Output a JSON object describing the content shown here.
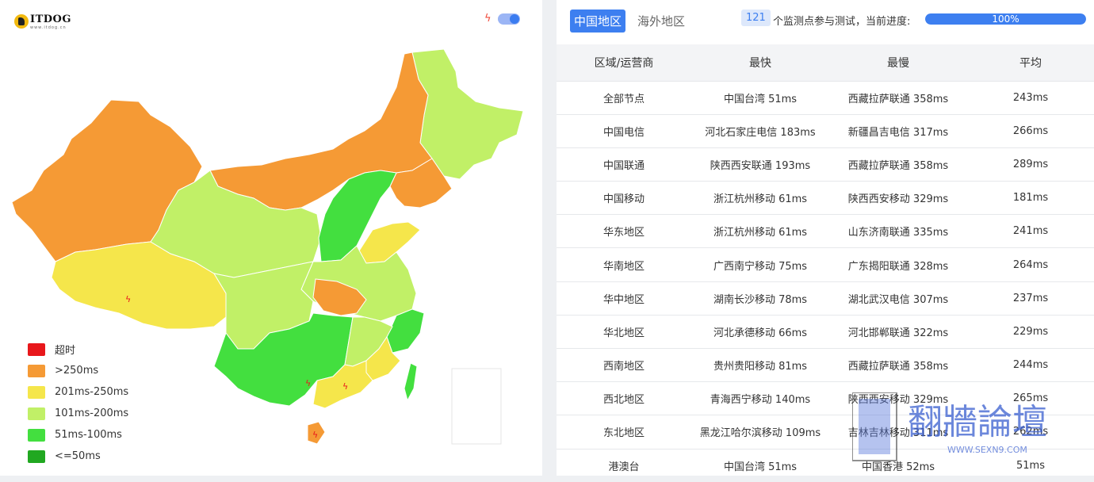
{
  "brand": {
    "name": "ITDOG",
    "url": "www.itdog.cn"
  },
  "legend": [
    {
      "label": "超时",
      "color": "#e8171b"
    },
    {
      "label": ">250ms",
      "color": "#f59a35"
    },
    {
      "label": "201ms-250ms",
      "color": "#f5e64b"
    },
    {
      "label": "101ms-200ms",
      "color": "#c1f067"
    },
    {
      "label": "51ms-100ms",
      "color": "#43df3f"
    },
    {
      "label": "<=50ms",
      "color": "#21a821"
    }
  ],
  "tabs": {
    "china": "中国地区",
    "overseas": "海外地区"
  },
  "test": {
    "count": "121",
    "text": "个监测点参与测试，当前进度:",
    "progress": "100%",
    "progress_value": 100
  },
  "table": {
    "headers": [
      "区域/运营商",
      "最快",
      "最慢",
      "平均"
    ],
    "rows": [
      [
        "全部节点",
        "中国台湾 51ms",
        "西藏拉萨联通 358ms",
        "243ms"
      ],
      [
        "中国电信",
        "河北石家庄电信 183ms",
        "新疆昌吉电信 317ms",
        "266ms"
      ],
      [
        "中国联通",
        "陕西西安联通 193ms",
        "西藏拉萨联通 358ms",
        "289ms"
      ],
      [
        "中国移动",
        "浙江杭州移动 61ms",
        "陕西西安移动 329ms",
        "181ms"
      ],
      [
        "华东地区",
        "浙江杭州移动 61ms",
        "山东济南联通 335ms",
        "241ms"
      ],
      [
        "华南地区",
        "广西南宁移动 75ms",
        "广东揭阳联通 328ms",
        "264ms"
      ],
      [
        "华中地区",
        "湖南长沙移动 78ms",
        "湖北武汉电信 307ms",
        "237ms"
      ],
      [
        "华北地区",
        "河北承德移动 66ms",
        "河北邯郸联通 322ms",
        "229ms"
      ],
      [
        "西南地区",
        "贵州贵阳移动 81ms",
        "西藏拉萨联通 358ms",
        "244ms"
      ],
      [
        "西北地区",
        "青海西宁移动 140ms",
        "陕西西安移动 329ms",
        "265ms"
      ],
      [
        "东北地区",
        "黑龙江哈尔滨移动 109ms",
        "吉林吉林移动 311ms",
        "262ms"
      ],
      [
        "港澳台",
        "中国台湾 51ms",
        "中国香港 52ms",
        "51ms"
      ]
    ]
  },
  "watermark": {
    "title": "翻牆論壇",
    "url": "WWW.SEXN9.COM"
  }
}
